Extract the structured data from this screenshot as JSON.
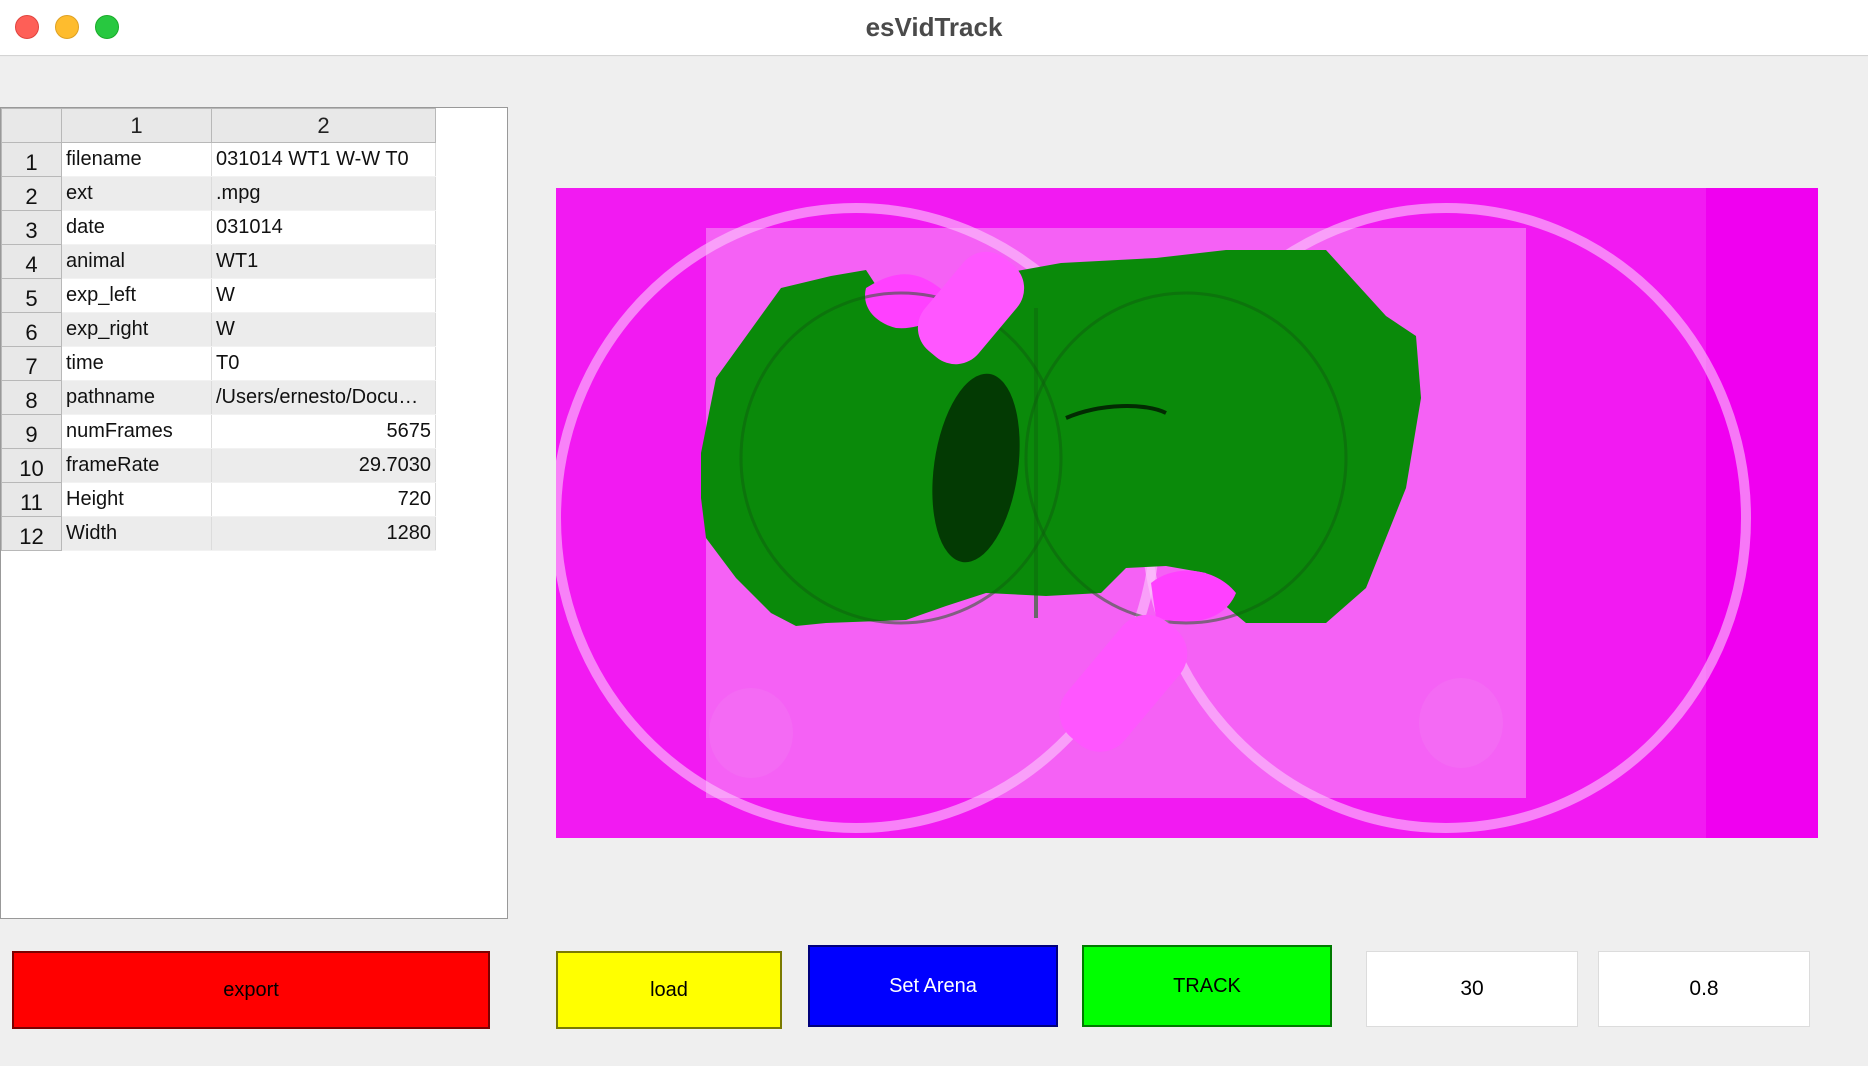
{
  "window": {
    "title": "esVidTrack"
  },
  "table": {
    "column_headers": [
      "1",
      "2"
    ],
    "rows": [
      {
        "index": "1",
        "key": "filename",
        "value": "031014 WT1 W-W T0"
      },
      {
        "index": "2",
        "key": "ext",
        "value": ".mpg"
      },
      {
        "index": "3",
        "key": "date",
        "value": "031014"
      },
      {
        "index": "4",
        "key": "animal",
        "value": "WT1"
      },
      {
        "index": "5",
        "key": "exp_left",
        "value": "W"
      },
      {
        "index": "6",
        "key": "exp_right",
        "value": "W"
      },
      {
        "index": "7",
        "key": "time",
        "value": "T0"
      },
      {
        "index": "8",
        "key": "pathname",
        "value": "/Users/ernesto/Docum..."
      },
      {
        "index": "9",
        "key": "numFrames",
        "value": "5675"
      },
      {
        "index": "10",
        "key": "frameRate",
        "value": "29.7030"
      },
      {
        "index": "11",
        "key": "Height",
        "value": "720"
      },
      {
        "index": "12",
        "key": "Width",
        "value": "1280"
      }
    ]
  },
  "buttons": {
    "export": "export",
    "load": "load",
    "set_arena": "Set Arena",
    "track": "TRACK"
  },
  "fields": {
    "field_1": "30",
    "field_2": "0.8"
  },
  "colors": {
    "export": "#ff0000",
    "load": "#ffff00",
    "set_arena": "#0000ff",
    "track": "#00ff00",
    "video_overlay": "#f21af2",
    "arena_mask": "#0a8a0a"
  }
}
